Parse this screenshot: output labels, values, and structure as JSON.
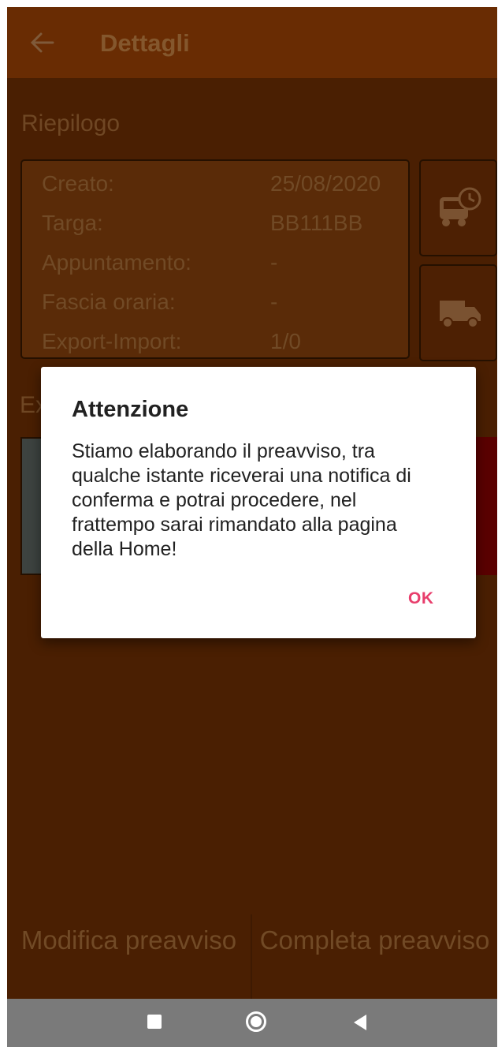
{
  "header": {
    "title": "Dettagli",
    "back_icon": "arrow-left-icon"
  },
  "summary": {
    "section_title": "Riepilogo",
    "rows": [
      {
        "label": "Creato:",
        "value": "25/08/2020"
      },
      {
        "label": "Targa:",
        "value": "BB111BB"
      },
      {
        "label": "Appuntamento:",
        "value": "-"
      },
      {
        "label": "Fascia oraria:",
        "value": "-"
      },
      {
        "label": "Export-Import:",
        "value": "1/0"
      }
    ],
    "side_buttons": [
      {
        "icon": "truck-clock-icon"
      },
      {
        "icon": "truck-icon"
      }
    ]
  },
  "export_section": {
    "title_partial": "Ex"
  },
  "bottom_actions": {
    "modify_label": "Modifica preavviso",
    "complete_label": "Completa preavviso"
  },
  "system_nav": {
    "recent_icon": "square-icon",
    "home_icon": "circle-icon",
    "back_icon": "triangle-back-icon"
  },
  "dialog": {
    "title": "Attenzione",
    "message": "Stiamo elaborando il preavviso, tra qualche istante riceverai una notifica di conferma e potrai procedere, nel frattempo sarai rimandato alla pagina della Home!",
    "ok_label": "OK",
    "accent_color": "#e83e6c"
  }
}
